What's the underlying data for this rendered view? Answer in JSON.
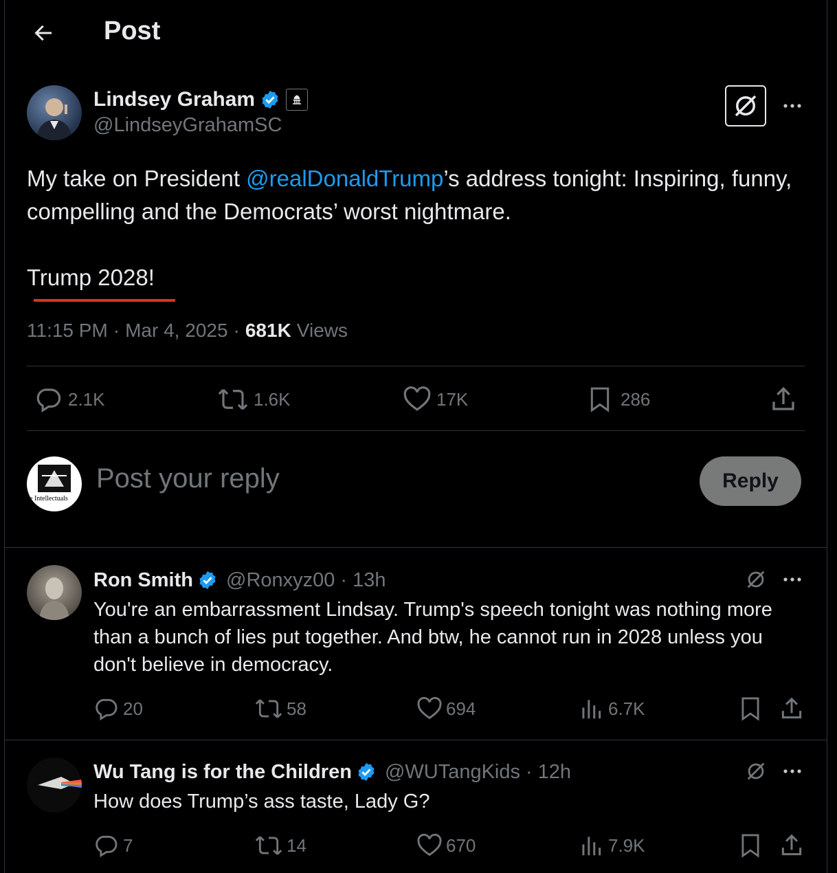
{
  "header": {
    "title": "Post"
  },
  "post": {
    "author_name": "Lindsey Graham",
    "author_handle": "@LindseyGrahamSC",
    "text_before": "My take on President ",
    "mention": "@realDonaldTrump",
    "text_after": "’s address tonight: Inspiring, funny, compelling and the Democrats’ worst nightmare.",
    "text_line2": "Trump 2028!",
    "time": "11:15 PM",
    "date": "Mar 4, 2025",
    "views_count": "681K",
    "views_label": "Views",
    "replies": "2.1K",
    "reposts": "1.6K",
    "likes": "17K",
    "bookmarks": "286"
  },
  "composer": {
    "placeholder": "Post your reply",
    "reply_button": "Reply",
    "avatar_text": "e Intellectuals"
  },
  "replies": [
    {
      "name": "Ron Smith",
      "handle": "@Ronxyz00",
      "time": "13h",
      "text": "You're an embarrassment Lindsay. Trump's speech tonight was nothing more than a bunch of lies put together. And btw, he cannot run in 2028 unless you don't believe in democracy.",
      "replies": "20",
      "reposts": "58",
      "likes": "694",
      "views": "6.7K"
    },
    {
      "name": "Wu Tang is for the Children",
      "handle": "@WUTangKids",
      "time": "12h",
      "text": "How does Trump’s ass taste, Lady G?",
      "replies": "7",
      "reposts": "14",
      "likes": "670",
      "views": "7.9K"
    }
  ],
  "colors": {
    "background": "#000000",
    "link": "#1d9bf0",
    "verified": "#1d9bf0",
    "muted": "#71767b",
    "underline": "#e0301e"
  }
}
